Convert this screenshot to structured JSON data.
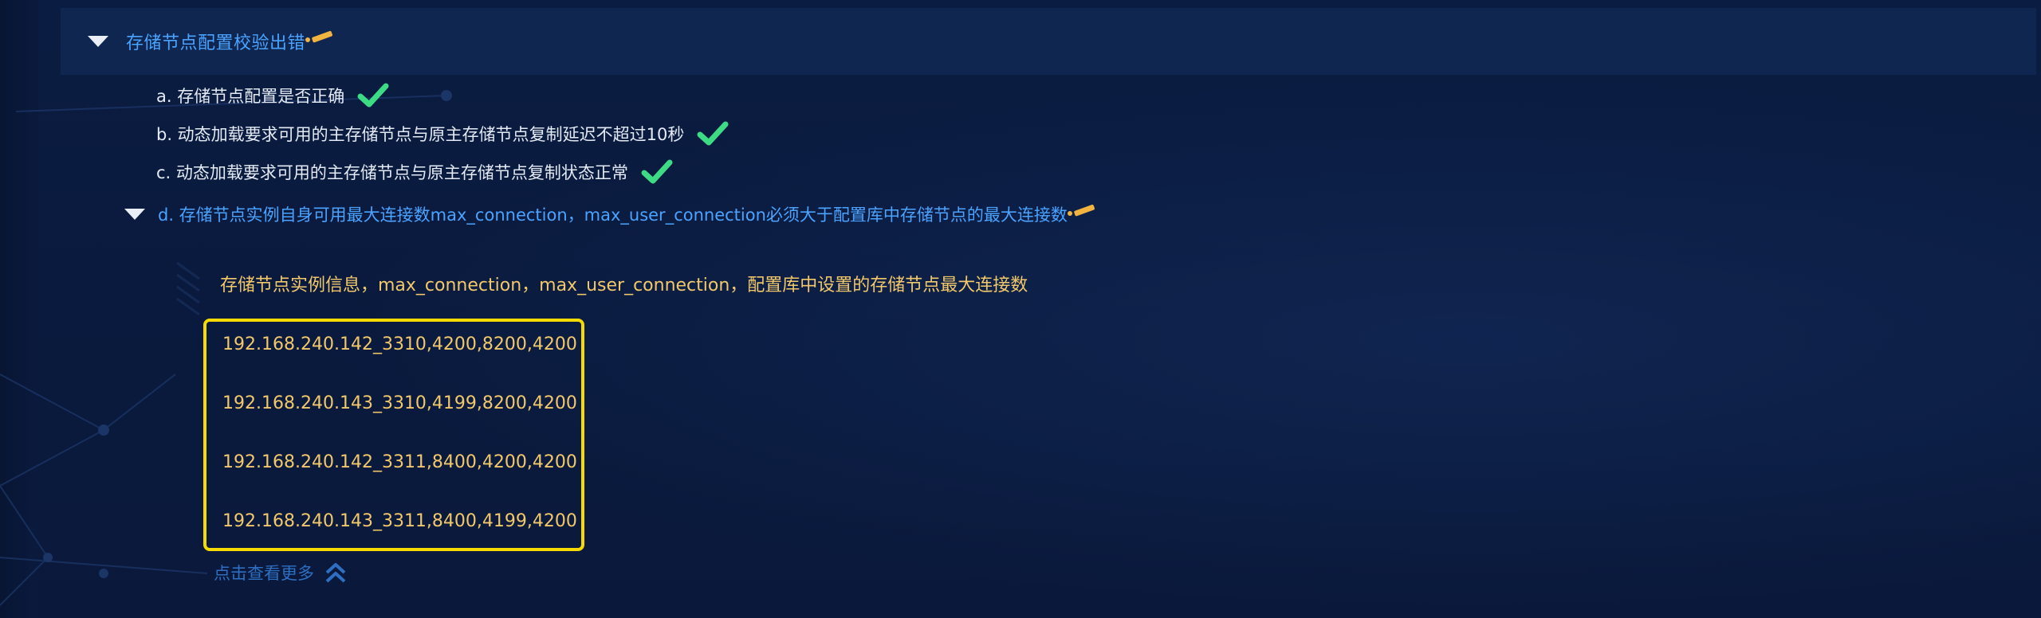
{
  "section": {
    "title": "存储节点配置校验出错"
  },
  "checks": [
    {
      "label": "a. 存储节点配置是否正确",
      "status": "pass"
    },
    {
      "label": "b. 动态加载要求可用的主存储节点与原主存储节点复制延迟不超过10秒",
      "status": "pass"
    },
    {
      "label": "c. 动态加载要求可用的主存储节点与原主存储节点复制状态正常",
      "status": "pass"
    },
    {
      "label": "d. 存储节点实例自身可用最大连接数max_connection，max_user_connection必须大于配置库中存储节点的最大连接数",
      "status": "error"
    }
  ],
  "detail": {
    "heading": "存储节点实例信息，max_connection，max_user_connection，配置库中设置的存储节点最大连接数",
    "lines": [
      "192.168.240.142_3310,4200,8200,4200",
      "192.168.240.143_3310,4199,8200,4200",
      "192.168.240.142_3311,8400,4200,4200",
      "192.168.240.143_3311,8400,4199,4200"
    ],
    "more_label": "点击查看更多"
  },
  "icons": {
    "expand": "caret-down-icon",
    "edit": "pencil-icon",
    "pass": "check-icon",
    "more": "double-chevron-up-icon"
  },
  "colors": {
    "background": "#0a1a3e",
    "header_bg": "#0e2650",
    "link_blue": "#4aa3ff",
    "check_green": "#3ddc84",
    "detail_text": "#f2c86a",
    "highlight_border": "#f6da00",
    "pencil": "#f2b440"
  }
}
